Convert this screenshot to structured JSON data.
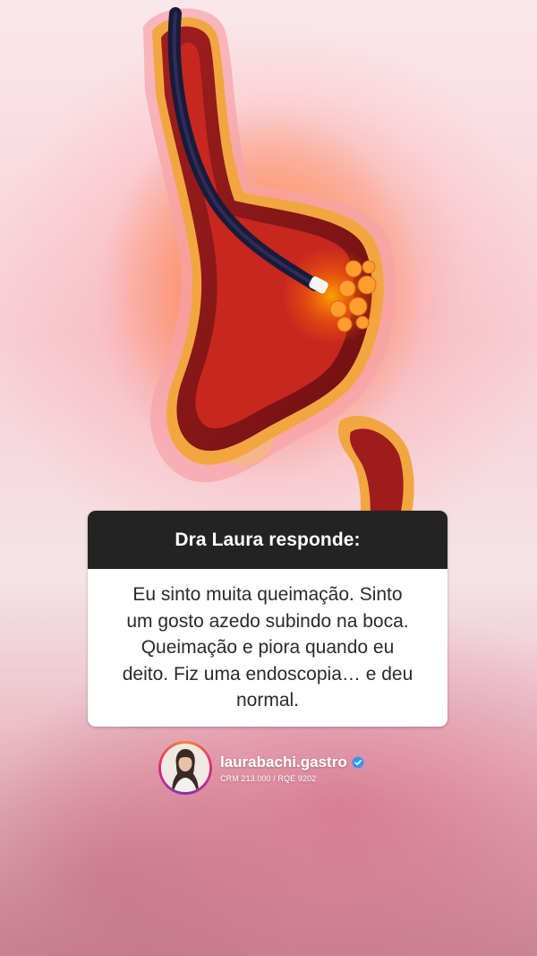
{
  "card": {
    "title": "Dra Laura responde:",
    "message": "Eu sinto muita queimação. Sinto um gosto azedo subindo na boca. Queimação e piora quando eu deito. Fiz uma endoscopia… e deu normal."
  },
  "profile": {
    "username": "laurabachi.gastro",
    "credentials": "CRM   213.000 / RQE 9202",
    "verified": true
  },
  "colors": {
    "card_header": "#232323",
    "verified_badge": "#3897f0"
  }
}
